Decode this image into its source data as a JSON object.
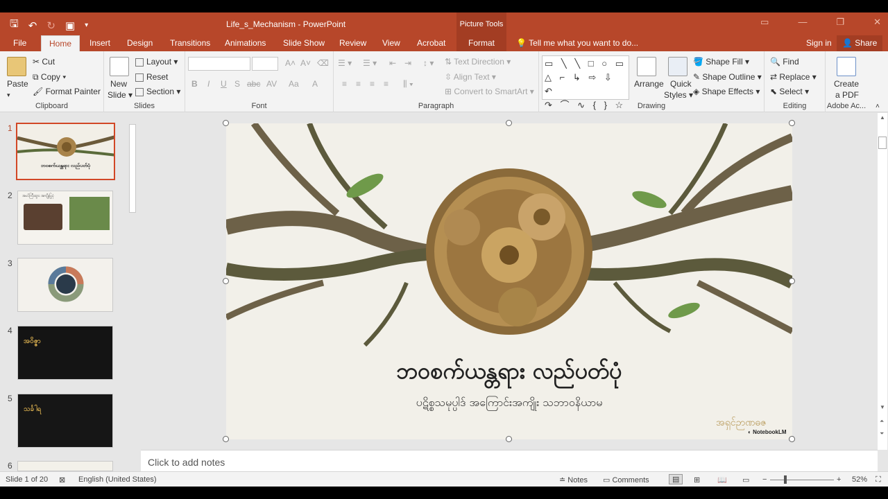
{
  "window": {
    "title": "Life_s_Mechanism - PowerPoint",
    "picture_tools_label": "Picture Tools",
    "accent": "#b7472a"
  },
  "tabs": [
    "File",
    "Home",
    "Insert",
    "Design",
    "Transitions",
    "Animations",
    "Slide Show",
    "Review",
    "View",
    "Acrobat",
    "Format"
  ],
  "tell_me": "Tell me what you want to do...",
  "sign_in": "Sign in",
  "share": "Share",
  "ribbon": {
    "clipboard": {
      "paste": "Paste",
      "cut": "Cut",
      "copy": "Copy",
      "format_painter": "Format Painter",
      "label": "Clipboard"
    },
    "slides": {
      "new_slide_line1": "New",
      "new_slide_line2": "Slide",
      "layout": "Layout",
      "reset": "Reset",
      "section": "Section",
      "label": "Slides"
    },
    "font": {
      "label": "Font",
      "bold": "B",
      "italic": "I",
      "underline": "U",
      "shadow": "S",
      "strike": "abc",
      "spacing": "AV",
      "case": "Aa",
      "color": "A"
    },
    "paragraph": {
      "text_direction": "Text Direction",
      "align_text": "Align Text",
      "convert_smartart": "Convert to SmartArt",
      "label": "Paragraph"
    },
    "drawing": {
      "arrange": "Arrange",
      "quick_styles_line1": "Quick",
      "quick_styles_line2": "Styles",
      "shape_fill": "Shape Fill",
      "shape_outline": "Shape Outline",
      "shape_effects": "Shape Effects",
      "label": "Drawing",
      "shapes_row1": "▭ ╲ ╲ □ ○ ▭",
      "shapes_row2": "△ ⌐ ↳ ⇨ ⇩ ↶",
      "shapes_row3": "↷ ⌒ ∿ { } ☆"
    },
    "editing": {
      "find": "Find",
      "replace": "Replace",
      "select": "Select",
      "label": "Editing"
    },
    "adobe": {
      "create_line1": "Create",
      "create_line2": "a PDF",
      "label": "Adobe Ac..."
    }
  },
  "thumbnails": [
    {
      "num": "1",
      "bg": "#f2efe7"
    },
    {
      "num": "2",
      "bg": "#f5f3ee"
    },
    {
      "num": "3",
      "bg": "#f3f1ec"
    },
    {
      "num": "4",
      "bg": "#141414"
    },
    {
      "num": "5",
      "bg": "#161616"
    },
    {
      "num": "6",
      "bg": "#f3f1ea"
    }
  ],
  "thumb_texts": {
    "t1_title": "ဘဝစက်ယန္တရား လည်ပတ်ပုံ",
    "t2_title": "အပင်ကြီးထွား အကျိုးပြုပုံ",
    "t4_heading": "အဝိဇ္ဇာ",
    "t5_heading": "သင်္ခါရ"
  },
  "slide": {
    "title": "ဘဝစက်ယန္တရား လည်ပတ်ပုံ",
    "subtitle": "ပဋိစ္စသမုပ္ပါဒ် အကြောင်းအကျိုး သဘာဝနိယာမ",
    "author": "အရှင်ဉာဏဓဇ",
    "brand": "NotebookLM"
  },
  "notes_placeholder": "Click to add notes",
  "status": {
    "slide_info": "Slide 1 of 20",
    "language": "English (United States)",
    "notes": "Notes",
    "comments": "Comments",
    "zoom": "52%"
  }
}
